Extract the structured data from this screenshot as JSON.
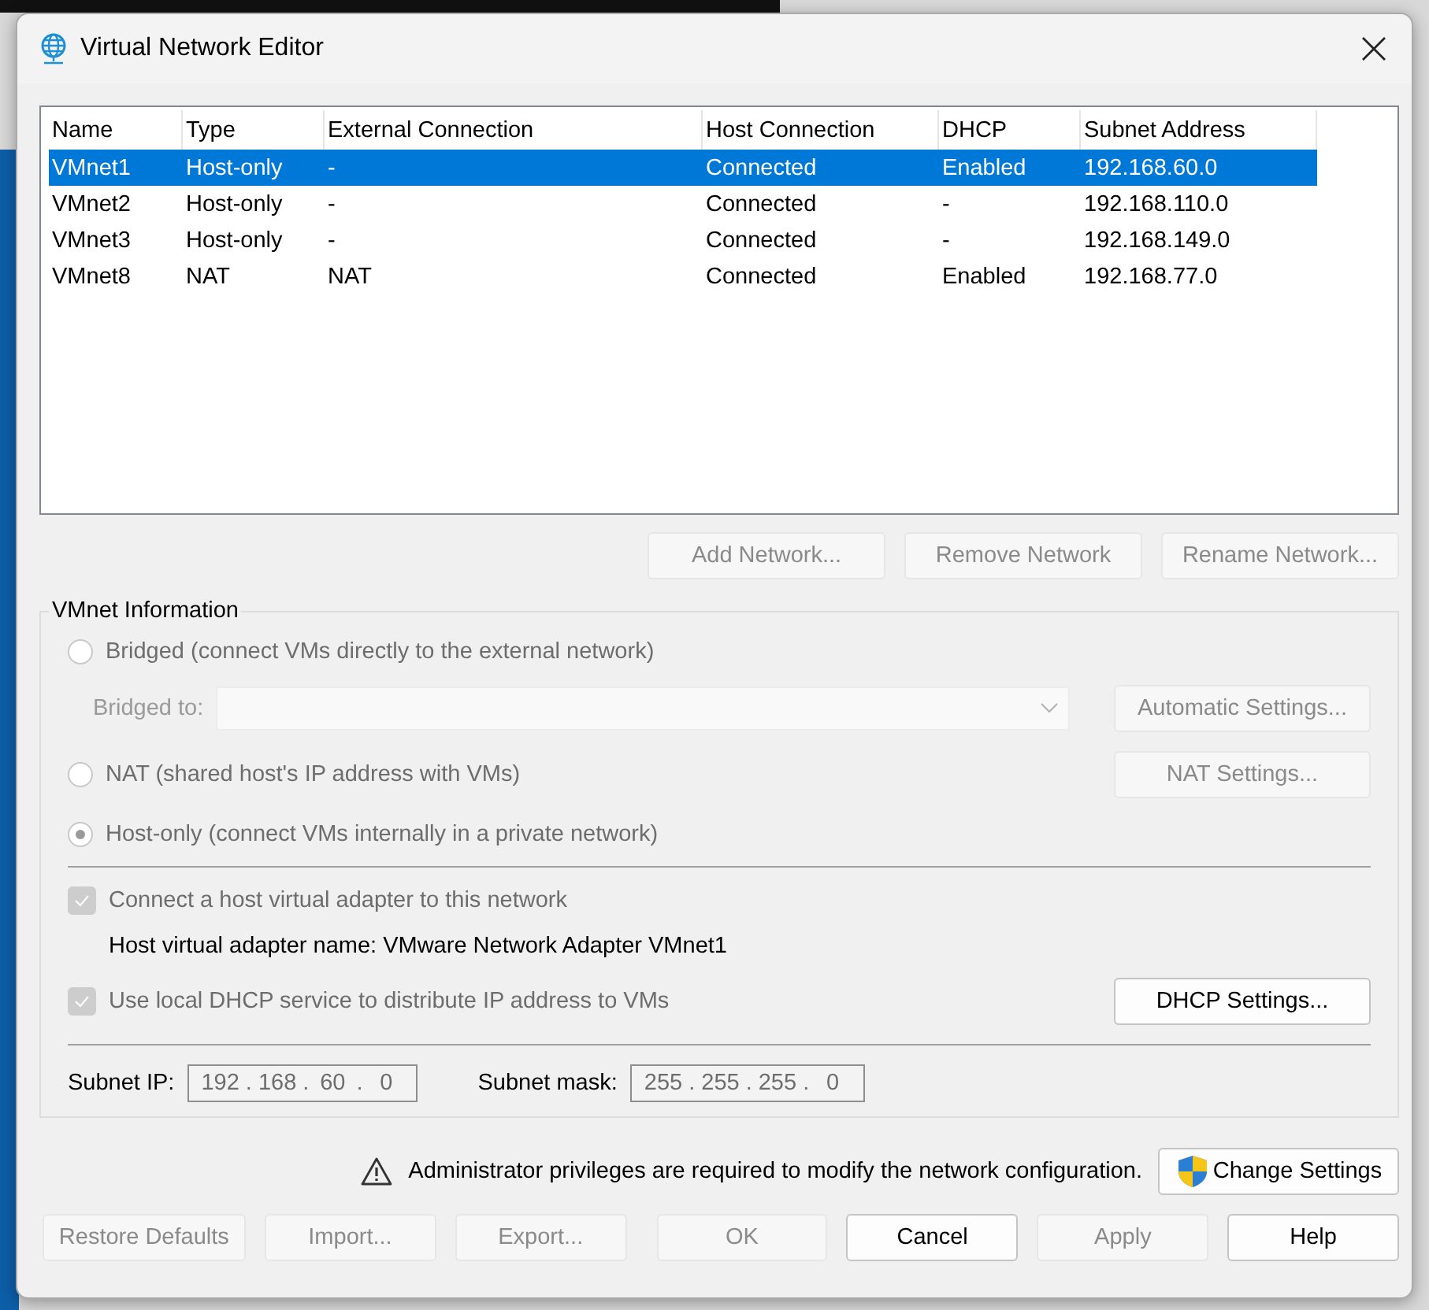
{
  "window": {
    "title": "Virtual Network Editor"
  },
  "table": {
    "columns": [
      "Name",
      "Type",
      "External Connection",
      "Host Connection",
      "DHCP",
      "Subnet Address"
    ],
    "rows": [
      {
        "cells": [
          "VMnet1",
          "Host-only",
          "-",
          "Connected",
          "Enabled",
          "192.168.60.0"
        ],
        "selected": true
      },
      {
        "cells": [
          "VMnet2",
          "Host-only",
          "-",
          "Connected",
          "-",
          "192.168.110.0"
        ],
        "selected": false
      },
      {
        "cells": [
          "VMnet3",
          "Host-only",
          "-",
          "Connected",
          "-",
          "192.168.149.0"
        ],
        "selected": false
      },
      {
        "cells": [
          "VMnet8",
          "NAT",
          "NAT",
          "Connected",
          "Enabled",
          "192.168.77.0"
        ],
        "selected": false
      }
    ]
  },
  "network_buttons": [
    {
      "label": "Add Network...",
      "disabled": true
    },
    {
      "label": "Remove Network",
      "disabled": true
    },
    {
      "label": "Rename Network...",
      "disabled": true
    }
  ],
  "vmnet_info": {
    "title": "VMnet Information",
    "bridged": {
      "label": "Bridged (connect VMs directly to the external network)",
      "selected": false,
      "disabled": true
    },
    "bridged_to": {
      "label": "Bridged to:",
      "disabled": true
    },
    "automatic_settings": {
      "label": "Automatic Settings...",
      "disabled": true
    },
    "nat": {
      "label": "NAT (shared host's IP address with VMs)",
      "selected": false,
      "disabled": true
    },
    "nat_settings": {
      "label": "NAT Settings...",
      "disabled": true
    },
    "host_only": {
      "label": "Host-only (connect VMs internally in a private network)",
      "selected": true,
      "disabled": true
    },
    "connect_adapter": {
      "label": "Connect a host virtual adapter to this network",
      "checked": true,
      "disabled": true
    },
    "adapter_name": "Host virtual adapter name: VMware Network Adapter VMnet1",
    "use_dhcp": {
      "label": "Use local DHCP service to distribute IP address to VMs",
      "checked": true,
      "disabled": true
    },
    "dhcp_settings": {
      "label": "DHCP Settings...",
      "disabled": false
    },
    "subnet_ip": {
      "label": "Subnet IP:",
      "octets": [
        "192",
        "168",
        "60",
        "0"
      ],
      "separator": "."
    },
    "subnet_mask": {
      "label": "Subnet mask:",
      "octets": [
        "255",
        "255",
        "255",
        "0"
      ],
      "separator": "."
    }
  },
  "warning": {
    "text": "Administrator privileges are required to modify the network configuration.",
    "button": "Change Settings"
  },
  "footer_buttons": [
    {
      "label": "Restore Defaults",
      "disabled": true
    },
    {
      "label": "Import...",
      "disabled": true
    },
    {
      "label": "Export...",
      "disabled": true
    },
    {
      "label": "OK",
      "disabled": true
    },
    {
      "label": "Cancel",
      "disabled": false
    },
    {
      "label": "Apply",
      "disabled": true
    },
    {
      "label": "Help",
      "disabled": false
    }
  ]
}
